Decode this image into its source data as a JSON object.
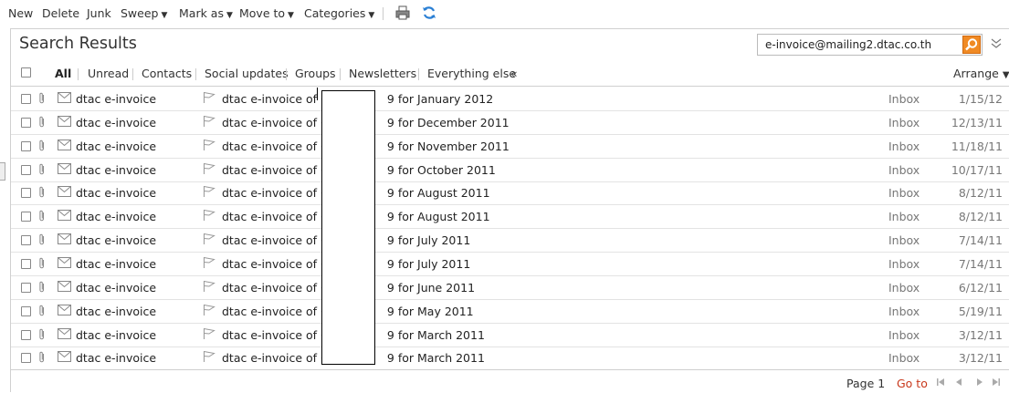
{
  "toolbar": {
    "items": [
      "New",
      "Delete",
      "Junk",
      "Sweep",
      "Mark as",
      "Move to",
      "Categories"
    ],
    "print_icon": "printer-icon",
    "refresh_icon": "refresh-icon"
  },
  "header": {
    "title": "Search Results",
    "search_value": "e-invoice@mailing2.dtac.co.th",
    "search_icon": "search-icon"
  },
  "filters": {
    "items": [
      "All",
      "Unread",
      "Contacts",
      "Social updates",
      "Groups",
      "Newsletters",
      "Everything else"
    ],
    "active": "All",
    "collapse_glyph": "«",
    "arrange_label": "Arrange"
  },
  "messages": [
    {
      "sender": "dtac e-invoice",
      "subject_prefix": "dtac e-invoice of 66",
      "subject_suffix": "9 for January 2012",
      "folder": "Inbox",
      "date": "1/15/12"
    },
    {
      "sender": "dtac e-invoice",
      "subject_prefix": "dtac e-invoice of 66",
      "subject_suffix": "9 for December 2011",
      "folder": "Inbox",
      "date": "12/13/11"
    },
    {
      "sender": "dtac e-invoice",
      "subject_prefix": "dtac e-invoice of 66",
      "subject_suffix": "9 for November 2011",
      "folder": "Inbox",
      "date": "11/18/11"
    },
    {
      "sender": "dtac e-invoice",
      "subject_prefix": "dtac e-invoice of 66",
      "subject_suffix": "9 for October 2011",
      "folder": "Inbox",
      "date": "10/17/11"
    },
    {
      "sender": "dtac e-invoice",
      "subject_prefix": "dtac e-invoice of 66",
      "subject_suffix": "9 for August 2011",
      "folder": "Inbox",
      "date": "8/12/11"
    },
    {
      "sender": "dtac e-invoice",
      "subject_prefix": "dtac e-invoice of 66",
      "subject_suffix": "9 for August 2011",
      "folder": "Inbox",
      "date": "8/12/11"
    },
    {
      "sender": "dtac e-invoice",
      "subject_prefix": "dtac e-invoice of 66",
      "subject_suffix": "9 for July 2011",
      "folder": "Inbox",
      "date": "7/14/11"
    },
    {
      "sender": "dtac e-invoice",
      "subject_prefix": "dtac e-invoice of 66",
      "subject_suffix": "9 for July 2011",
      "folder": "Inbox",
      "date": "7/14/11"
    },
    {
      "sender": "dtac e-invoice",
      "subject_prefix": "dtac e-invoice of 66",
      "subject_suffix": "9 for June 2011",
      "folder": "Inbox",
      "date": "6/12/11"
    },
    {
      "sender": "dtac e-invoice",
      "subject_prefix": "dtac e-invoice of 66",
      "subject_suffix": "9 for May 2011",
      "folder": "Inbox",
      "date": "5/19/11"
    },
    {
      "sender": "dtac e-invoice",
      "subject_prefix": "dtac e-invoice of 66",
      "subject_suffix": "9 for March 2011",
      "folder": "Inbox",
      "date": "3/12/11"
    },
    {
      "sender": "dtac e-invoice",
      "subject_prefix": "dtac e-invoice of 66",
      "subject_suffix": "9 for March 2011",
      "folder": "Inbox",
      "date": "3/12/11"
    }
  ],
  "footer": {
    "page_label": "Page 1",
    "goto_label": "Go to"
  },
  "colors": {
    "accent": "#f08a24",
    "link_red": "#c8381c",
    "refresh_blue": "#2a7fd4"
  }
}
